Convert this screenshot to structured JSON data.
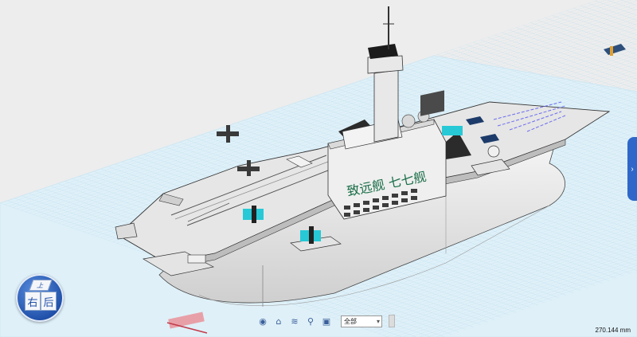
{
  "viewport": {
    "background": "#ededed",
    "grid_color": "#9fd0ea"
  },
  "scene": {
    "hull_text": "致远舰 七七舰",
    "deck_color": "#e6e6e6",
    "aircraft_color": "#27c9d6"
  },
  "view_cube": {
    "top_label": "上",
    "left_label": "右",
    "right_label": "后"
  },
  "toolbar": {
    "items": [
      {
        "icon": "eye-icon"
      },
      {
        "icon": "home-icon"
      },
      {
        "icon": "layers-icon"
      },
      {
        "icon": "zoom-icon"
      },
      {
        "icon": "fit-icon"
      }
    ],
    "filter_value": "全部"
  },
  "side_panel": {
    "icon": "chevron-right-icon"
  },
  "status": {
    "dimension": "270.144 mm"
  }
}
